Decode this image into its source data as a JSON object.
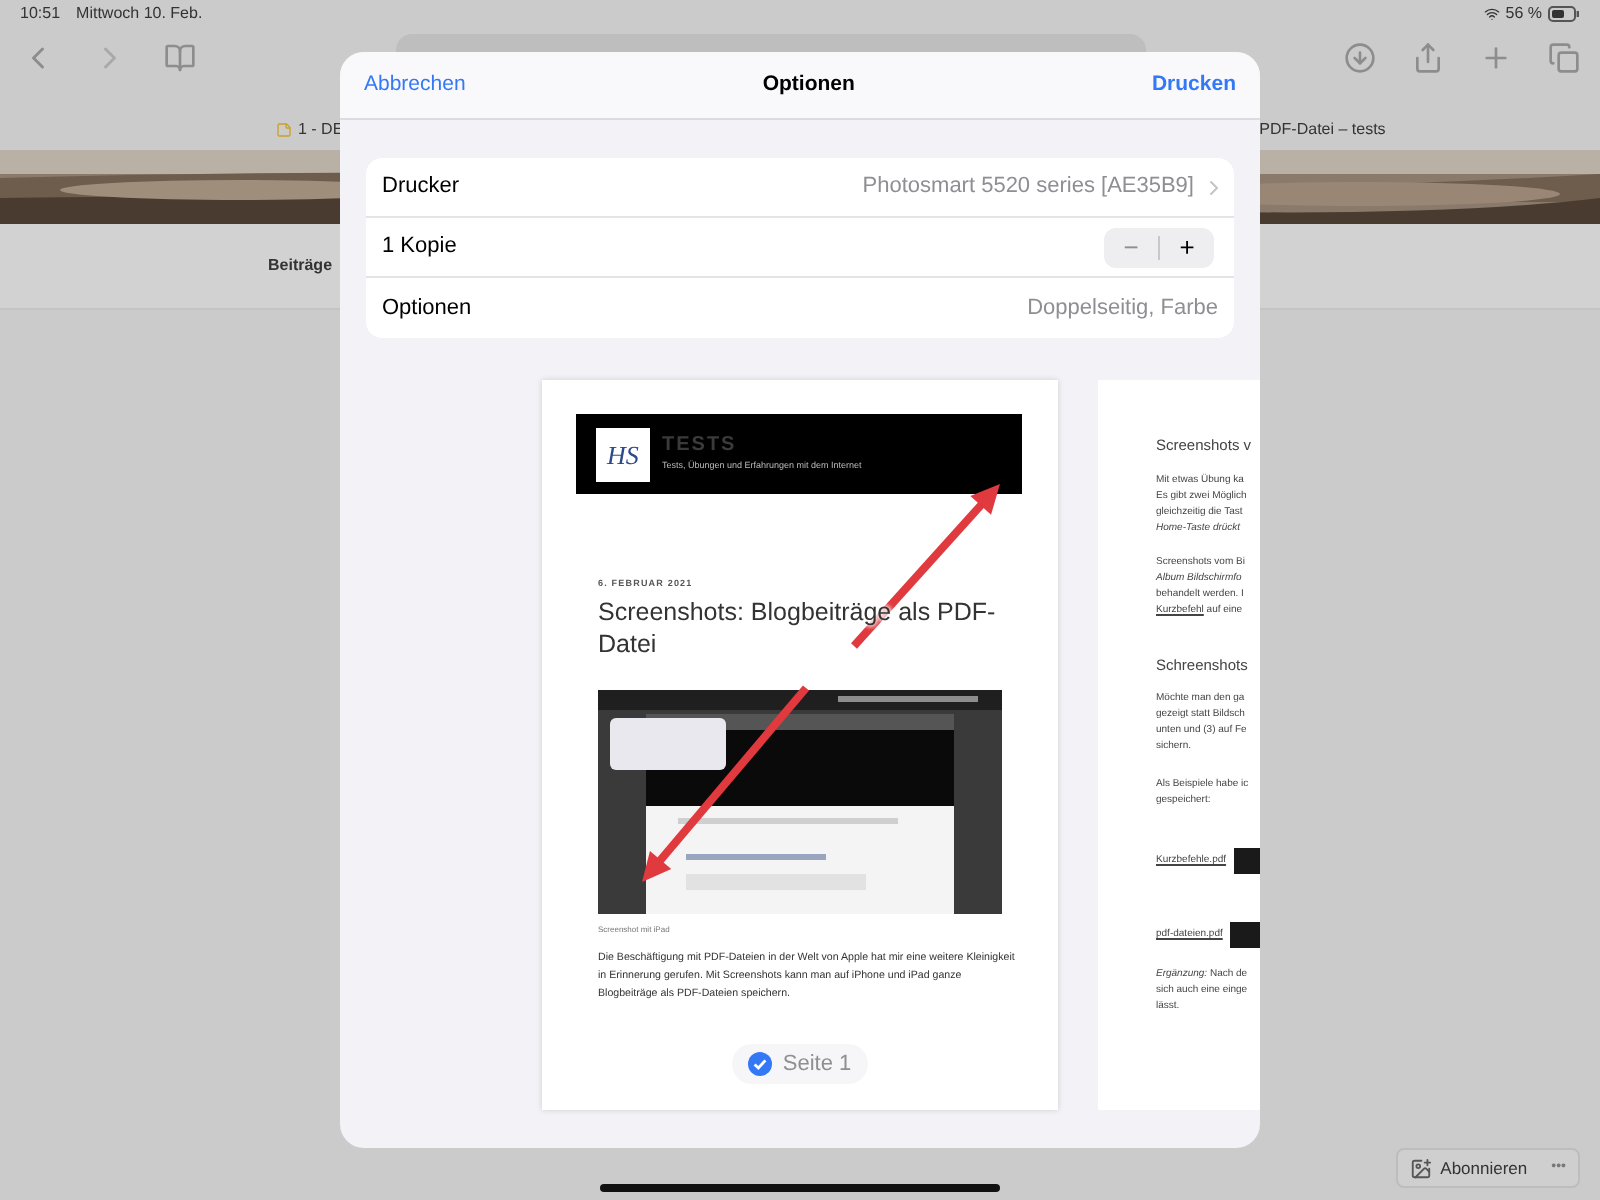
{
  "status_bar": {
    "time": "10:51",
    "date": "Mittwoch 10. Feb.",
    "battery": "56 %"
  },
  "browser": {
    "tabs": [
      {
        "label": "1 - DE"
      },
      {
        "label": "PDF-Datei – tests"
      }
    ],
    "nav_item": "Beiträge",
    "subscribe_button": "Abonnieren",
    "more_button": "•••"
  },
  "dialog": {
    "cancel": "Abbrechen",
    "title": "Optionen",
    "confirm": "Drucken",
    "rows": [
      {
        "kind": "link",
        "label": "Drucker",
        "value": "Photosmart 5520 series [AE35B9]"
      },
      {
        "kind": "stepper",
        "label": "1 Kopie",
        "minus": "−",
        "plus": "+"
      },
      {
        "kind": "value",
        "label": "Optionen",
        "value": "Doppelseitig, Farbe"
      }
    ]
  },
  "preview": {
    "page_1": {
      "logo": "HS",
      "site_title": "TESTS",
      "tagline": "Tests, Übungen und Erfahrungen mit dem Internet",
      "date": "6. FEBRUAR 2021",
      "title": "Screenshots: Blogbeiträge als PDF-Datei",
      "caption": "Screenshot mit iPad",
      "paragraph": "Die Beschäftigung mit PDF-Dateien in der Welt von Apple hat mir eine weitere Kleinigkeit in Erinnerung gerufen. Mit Screenshots kann man auf iPhone und iPad ganze Blogbeiträge als PDF-Dateien speichern.",
      "page_label": "Seite 1",
      "selected": true
    },
    "page_2": [
      {
        "kind": "heading",
        "text": "Screenshots v"
      },
      {
        "kind": "paragraph",
        "lines": [
          "Mit etwas Übung ka",
          "Es gibt zwei Möglich",
          "gleichzeitig die Tast",
          "*Home-Taste drückt*"
        ]
      },
      {
        "kind": "paragraph",
        "lines": [
          "Screenshots vom Bi",
          "*Album Bildschirmfo*",
          "behandelt werden. I",
          {
            "link": "Kurzbefehl",
            "text": " auf eine"
          }
        ]
      },
      {
        "kind": "heading",
        "text": "Schreenshots"
      },
      {
        "kind": "paragraph",
        "lines": [
          "Möchte man den ga",
          "gezeigt statt Bildsch",
          "unten und (3) auf Fe",
          "sichern."
        ]
      },
      {
        "kind": "paragraph",
        "lines": [
          "Als Beispiele habe ic",
          "gespeichert:"
        ]
      },
      {
        "kind": "file",
        "text": "Kurzbefehle.pdf"
      },
      {
        "kind": "file",
        "text": "pdf-dateien.pdf"
      },
      {
        "kind": "paragraph",
        "lines": [
          "*Ergänzung:* Nach de",
          "sich auch eine einge",
          "lässt."
        ]
      }
    ]
  }
}
